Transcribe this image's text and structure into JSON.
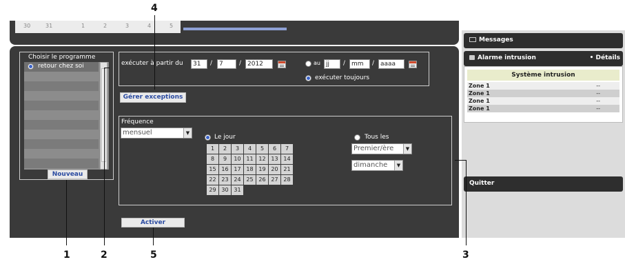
{
  "top_strip": {
    "tabs": [
      "30",
      "31",
      "1",
      "2",
      "3",
      "4",
      "5"
    ]
  },
  "program_panel": {
    "title": "Choisir le programme",
    "selected_program": "retour chez soi",
    "new_button": "Nouveau"
  },
  "schedule": {
    "from_label": "exécuter à partir du",
    "from_day": "31",
    "from_month": "7",
    "from_year": "2012",
    "to_label": "au",
    "to_day_placeholder": "jj",
    "to_month_placeholder": "mm",
    "to_year_placeholder": "aaaa",
    "always_label": "exécuter toujours",
    "slash": "/"
  },
  "exceptions_button": "Gérer exceptions",
  "frequency": {
    "label": "Fréquence",
    "mode": "mensuel",
    "day_option_label": "Le jour",
    "every_option_label": "Tous les",
    "every_which": "Premier/ère",
    "every_weekday": "dimanche",
    "calendar_days": [
      "1",
      "2",
      "3",
      "4",
      "5",
      "6",
      "7",
      "8",
      "9",
      "10",
      "11",
      "12",
      "13",
      "14",
      "15",
      "16",
      "17",
      "18",
      "19",
      "20",
      "21",
      "22",
      "23",
      "24",
      "25",
      "26",
      "27",
      "28",
      "29",
      "30",
      "31"
    ]
  },
  "activate_button": "Activer",
  "right_panel": {
    "messages_title": "Messages",
    "alarm_title": "Alarme intrusion",
    "details_link": "• Détails",
    "system_header": "Système intrusion",
    "zones": [
      {
        "name": "Zone 1",
        "value": "--"
      },
      {
        "name": "Zone 1",
        "value": "--"
      },
      {
        "name": "Zone 1",
        "value": "--"
      },
      {
        "name": "Zone 1",
        "value": "--"
      }
    ],
    "quit_label": "Quitter"
  },
  "callouts": [
    "1",
    "2",
    "3",
    "4",
    "5"
  ],
  "colors": {
    "panel": "#3a3a3a",
    "accent_blue": "#2a4aa0",
    "right_panel_bg": "#dcdcdc"
  }
}
